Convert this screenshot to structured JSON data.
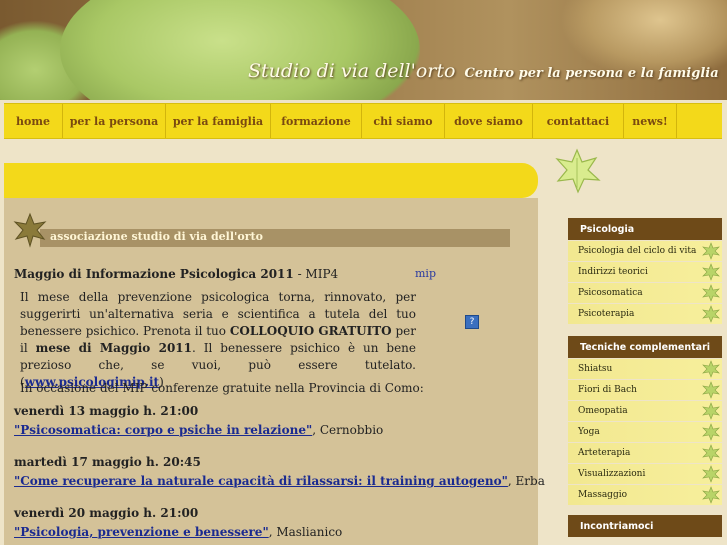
{
  "header": {
    "title": "Studio di via dell'orto",
    "subtitle": "Centro per la persona e la famiglia"
  },
  "nav": [
    {
      "label": "home"
    },
    {
      "label": "per la persona"
    },
    {
      "label": "per la famiglia"
    },
    {
      "label": "formazione"
    },
    {
      "label": "chi siamo"
    },
    {
      "label": "dove siamo"
    },
    {
      "label": "contattaci"
    },
    {
      "label": "news!"
    }
  ],
  "section": {
    "title": "associazione studio di via dell'orto"
  },
  "article": {
    "title_bold": "Maggio di Informazione Psicologica 2011",
    "title_rest": " - MIP4",
    "mip_link": "mip",
    "p1_a": "Il mese della prevenzione psicologica torna, rinnovato, per suggerirti un'alternativa seria e scientifica a tutela del tuo benessere psichico. Prenota il tuo ",
    "p1_b": "COLLOQUIO GRATUITO",
    "p1_c": " per il ",
    "p1_d": "mese di Maggio 2011",
    "p1_e": ". Il benessere psichico è un bene prezioso che, se vuoi, può essere tutelato. (",
    "p1_link": "www.psicologimip.it",
    "p1_f": ")",
    "p2": "In occasione del MIP conferenze gratuite nella Provincia di Como:",
    "help_icon": "?"
  },
  "events": [
    {
      "date": "venerdì 13 maggio h. 21:00",
      "link": "\"Psicosomatica: corpo e psiche in relazione\"",
      "place": ", Cernobbio"
    },
    {
      "date": "martedì 17 maggio h. 20:45",
      "link": "\"Come recuperare la naturale capacità di rilassarsi: il training autogeno\"",
      "place": ", Erba"
    },
    {
      "date": "venerdì 20 maggio h. 21:00",
      "link": "\"Psicologia, prevenzione e benessere\"",
      "place": ", Maslianico"
    }
  ],
  "sidebar": {
    "psicologia": {
      "heading": "Psicologia",
      "items": [
        "Psicologia del ciclo di vita",
        "Indirizzi teorici",
        "Psicosomatica",
        "Psicoterapia"
      ]
    },
    "tecniche": {
      "heading": "Tecniche complementari",
      "items": [
        "Shiatsu",
        "Fiori di Bach",
        "Omeopatia",
        "Yoga",
        "Arteterapia",
        "Visualizzazioni",
        "Massaggio"
      ]
    },
    "incontriamoci": {
      "heading": "Incontriamoci"
    }
  },
  "colors": {
    "nav_bg": "#f3d91a",
    "nav_text": "#7a4a10",
    "content_bg": "#d4c298",
    "sidebar_head": "#6e4a18",
    "link": "#1a2a90"
  }
}
